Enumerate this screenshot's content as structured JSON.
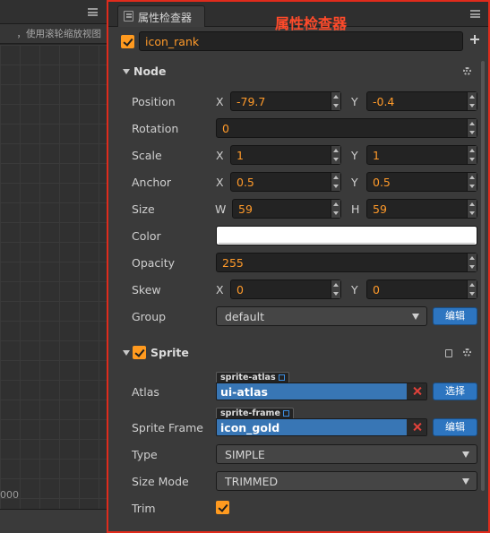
{
  "scene": {
    "hint": "，使用滚轮缩放视图",
    "coord_text": "000"
  },
  "inspector": {
    "tab_title": "属性检查器",
    "annotation": "属性检查器",
    "node_name": "icon_rank",
    "node_active": true,
    "accent_color": "#ff9a1f",
    "highlight_border_color": "#e02b1c",
    "button_color": "#2d75c0",
    "node_section": {
      "title": "Node",
      "position": {
        "label": "Position",
        "x_label": "X",
        "x": "-79.7",
        "y_label": "Y",
        "y": "-0.4"
      },
      "rotation": {
        "label": "Rotation",
        "value": "0"
      },
      "scale": {
        "label": "Scale",
        "x_label": "X",
        "x": "1",
        "y_label": "Y",
        "y": "1"
      },
      "anchor": {
        "label": "Anchor",
        "x_label": "X",
        "x": "0.5",
        "y_label": "Y",
        "y": "0.5"
      },
      "size": {
        "label": "Size",
        "w_label": "W",
        "w": "59",
        "h_label": "H",
        "h": "59"
      },
      "color": {
        "label": "Color",
        "value": "#ffffff"
      },
      "opacity": {
        "label": "Opacity",
        "value": "255"
      },
      "skew": {
        "label": "Skew",
        "x_label": "X",
        "x": "0",
        "y_label": "Y",
        "y": "0"
      },
      "group": {
        "label": "Group",
        "value": "default",
        "edit_button": "编辑"
      }
    },
    "sprite_section": {
      "title": "Sprite",
      "enabled": true,
      "atlas": {
        "label": "Atlas",
        "tag": "sprite-atlas",
        "value": "ui-atlas",
        "select_button": "选择"
      },
      "sprite_frame": {
        "label": "Sprite Frame",
        "tag": "sprite-frame",
        "value": "icon_gold",
        "edit_button": "编辑"
      },
      "type": {
        "label": "Type",
        "value": "SIMPLE"
      },
      "size_mode": {
        "label": "Size Mode",
        "value": "TRIMMED"
      },
      "trim": {
        "label": "Trim",
        "checked": true
      }
    }
  }
}
